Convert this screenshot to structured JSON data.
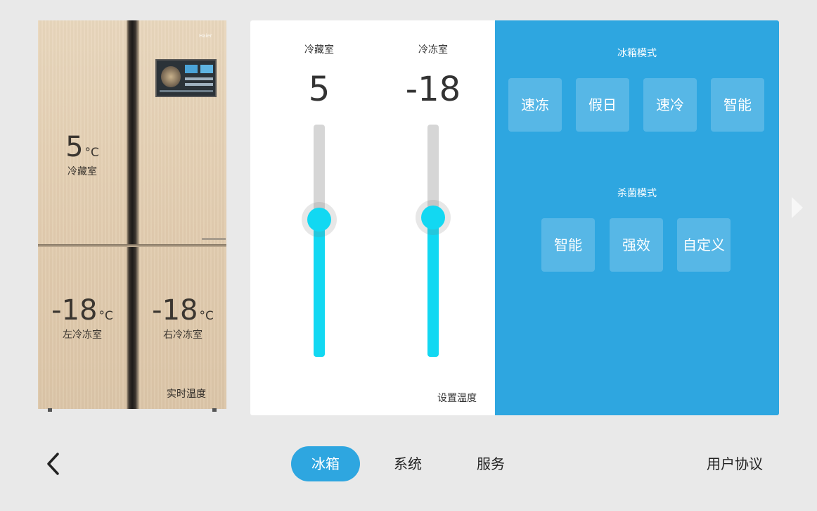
{
  "fridge_picture": {
    "brand": "Haier",
    "refrigerator": {
      "value": "5",
      "unit": "°C",
      "label": "冷藏室"
    },
    "left_freezer": {
      "value": "-18",
      "unit": "°C",
      "label": "左冷冻室"
    },
    "right_freezer": {
      "value": "-18",
      "unit": "°C",
      "label": "右冷冻室"
    },
    "caption": "实时温度"
  },
  "set_temperature": {
    "refrigerator": {
      "label": "冷藏室",
      "value": "5",
      "slider_fraction": 0.59
    },
    "freezer": {
      "label": "冷冻室",
      "value": "-18",
      "slider_fraction": 0.6
    },
    "caption": "设置温度",
    "fill_color": "#12d8f2"
  },
  "fridge_mode": {
    "title": "冰箱模式",
    "buttons": [
      "速冻",
      "假日",
      "速冷",
      "智能"
    ]
  },
  "sterilize_mode": {
    "title": "杀菌模式",
    "buttons": [
      "智能",
      "强效",
      "自定义"
    ]
  },
  "colors": {
    "accent": "#2ea6e0",
    "background": "#e9e9e9"
  },
  "nav": {
    "back_icon": "chevron-left-icon",
    "next_icon": "chevron-right-icon",
    "tabs": [
      {
        "label": "冰箱",
        "active": true
      },
      {
        "label": "系统",
        "active": false
      },
      {
        "label": "服务",
        "active": false
      }
    ],
    "agreement": "用户协议"
  }
}
